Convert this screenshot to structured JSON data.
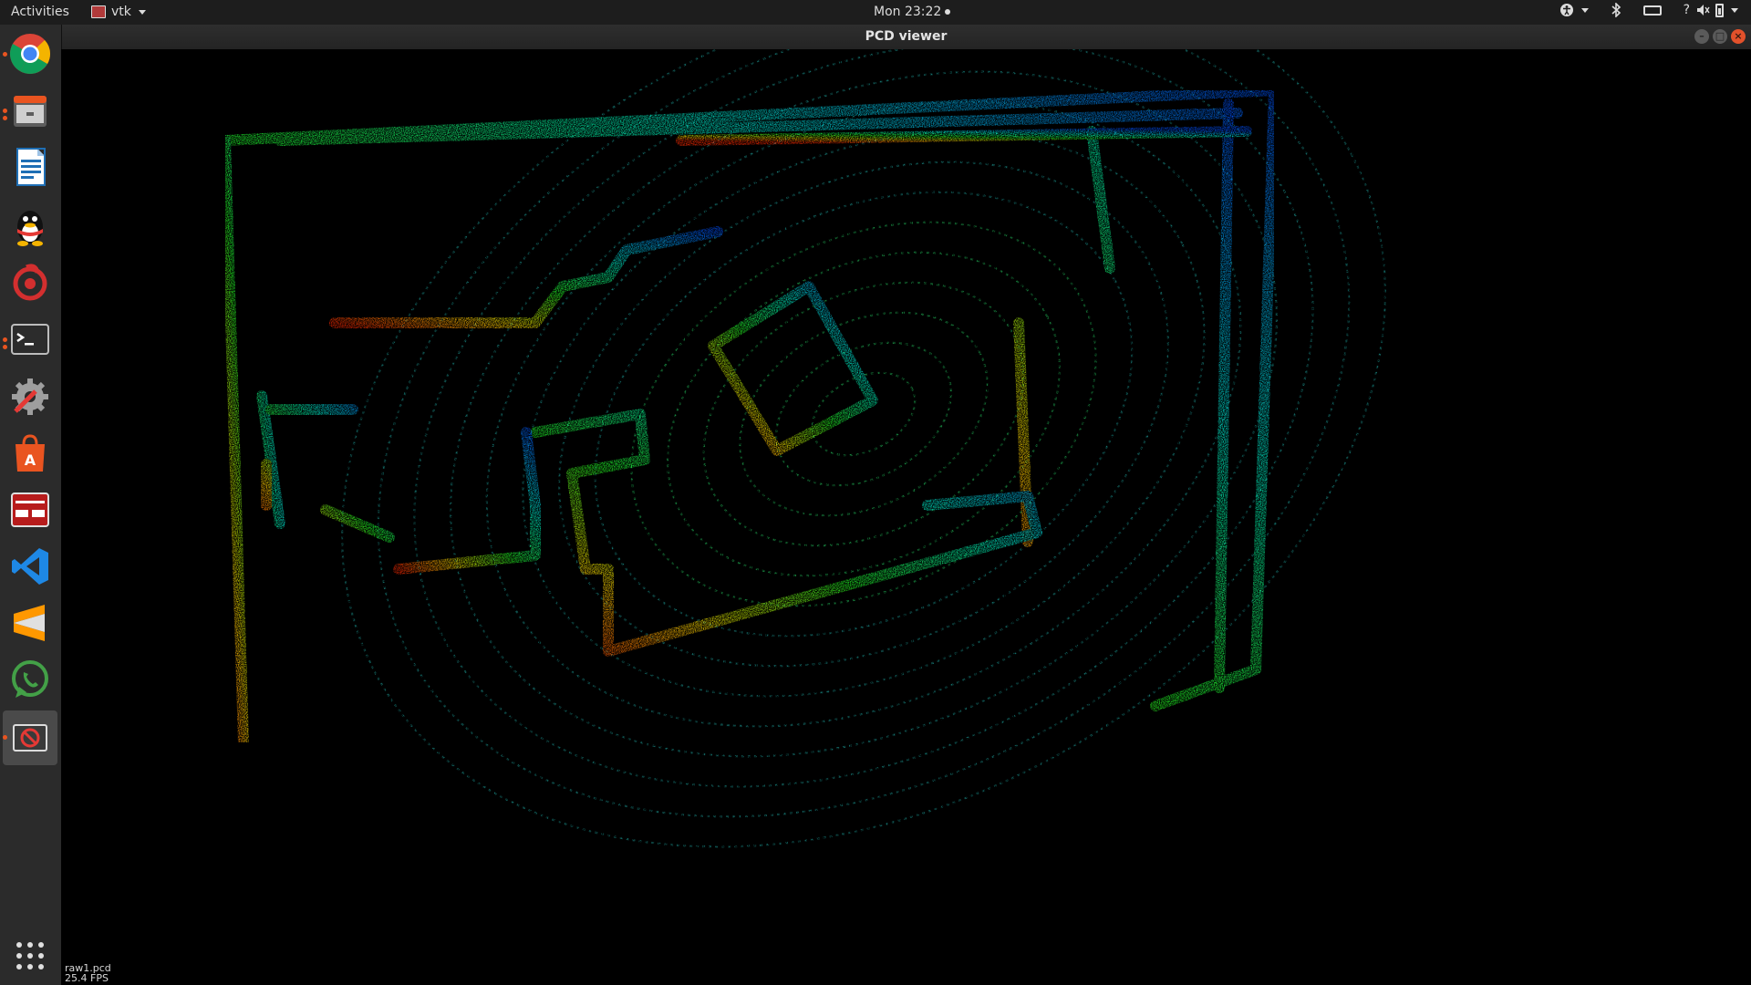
{
  "topbar": {
    "activities": "Activities",
    "app_name": "vtk",
    "clock": "Mon 23:22",
    "tray_help": "?"
  },
  "window": {
    "title": "PCD viewer"
  },
  "viewer": {
    "cloud_name": "raw1.pcd",
    "fps": "25.4 FPS"
  },
  "dock": {
    "apps": [
      {
        "icon": "chrome-icon"
      },
      {
        "icon": "files-icon"
      },
      {
        "icon": "writer-icon"
      },
      {
        "icon": "qq-icon"
      },
      {
        "icon": "netease-music-icon"
      },
      {
        "icon": "terminal-icon"
      },
      {
        "icon": "settings-tools-icon"
      },
      {
        "icon": "software-center-icon"
      },
      {
        "icon": "app-red-icon"
      },
      {
        "icon": "vscode-icon"
      },
      {
        "icon": "sublime-icon"
      },
      {
        "icon": "whatsapp-icon"
      },
      {
        "icon": "pcd-viewer-icon"
      }
    ],
    "show_apps_icon": "show-apps-icon"
  },
  "colors": {
    "ubuntu_orange": "#e95420",
    "topbar_bg": "#1d1d1d",
    "dock_bg": "#2b2b2b"
  }
}
